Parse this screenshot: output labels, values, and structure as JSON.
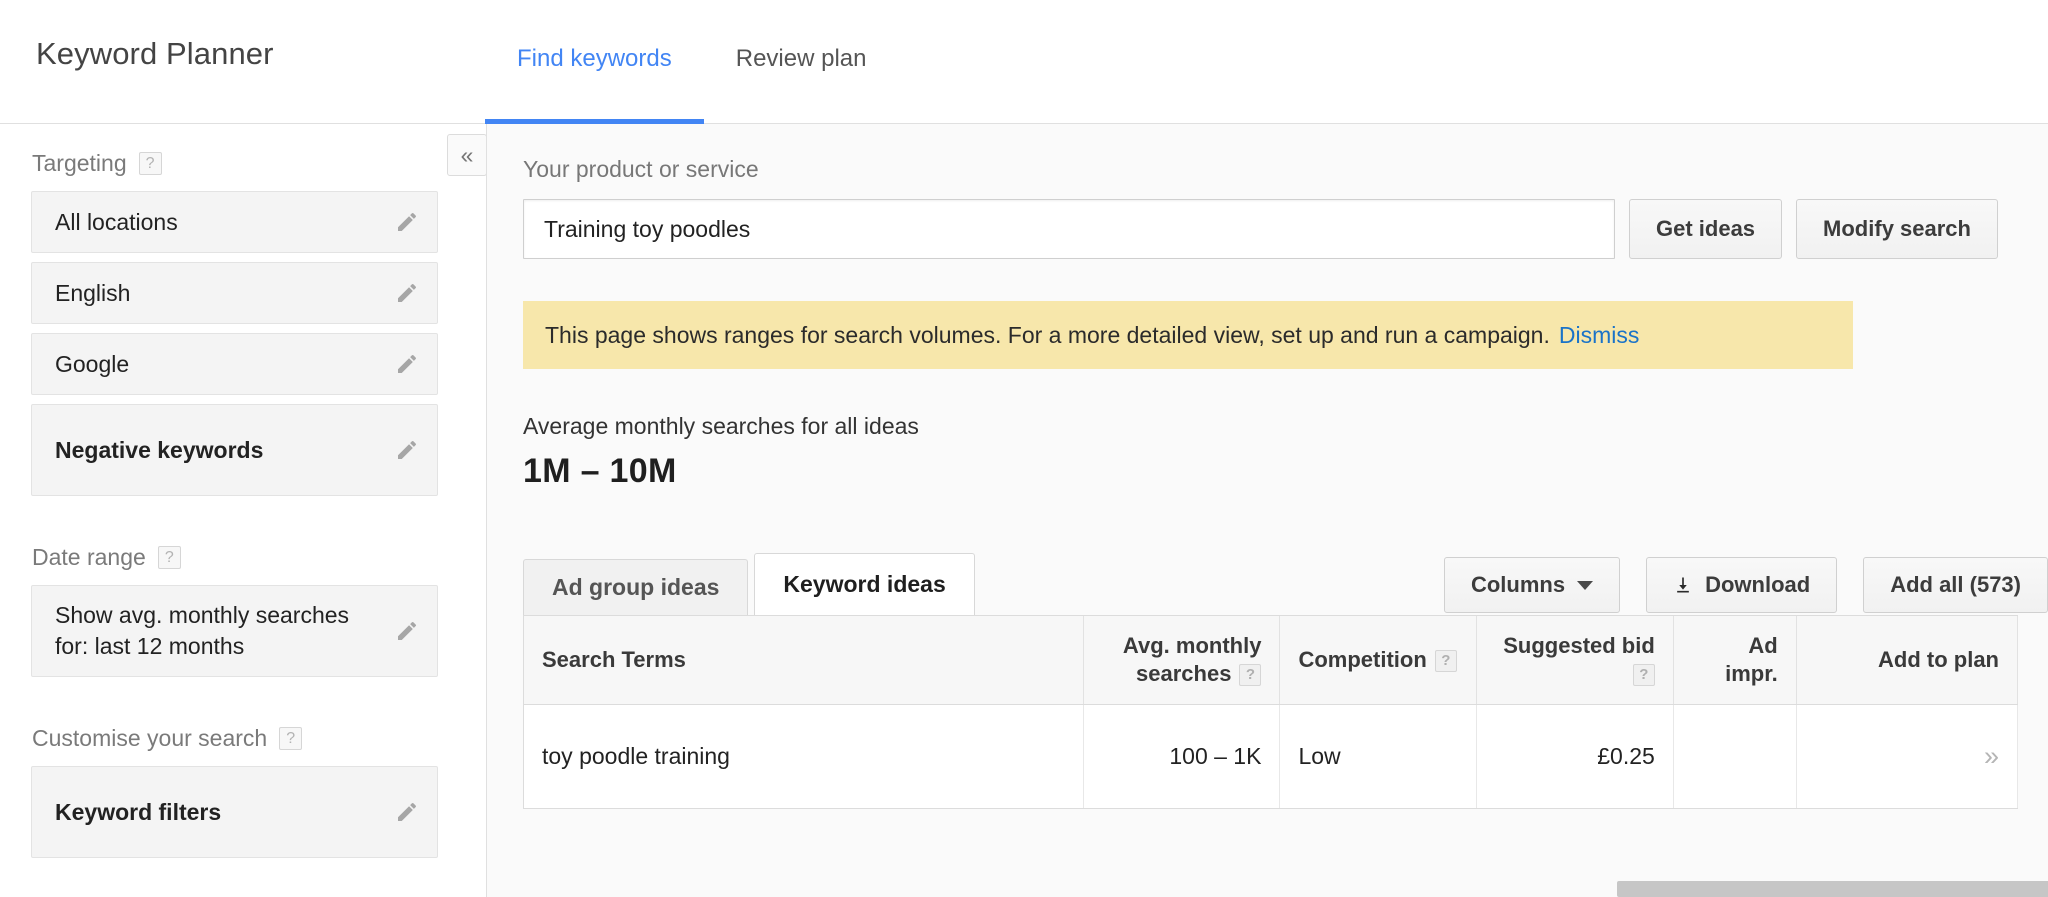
{
  "header": {
    "title": "Keyword Planner",
    "tabs": [
      {
        "label": "Find keywords",
        "active": true
      },
      {
        "label": "Review plan",
        "active": false
      }
    ]
  },
  "sidebar": {
    "collapse_icon": "«",
    "groups": [
      {
        "title": "Targeting",
        "help": "?",
        "items": [
          {
            "label": "All locations",
            "bold": false
          },
          {
            "label": "English",
            "bold": false
          },
          {
            "label": "Google",
            "bold": false
          },
          {
            "label": "Negative keywords",
            "bold": true
          }
        ]
      },
      {
        "title": "Date range",
        "help": "?",
        "items": [
          {
            "label": "Show avg. monthly searches for: last 12 months",
            "bold": false,
            "tall": true
          }
        ]
      },
      {
        "title": "Customise your search",
        "help": "?",
        "items": [
          {
            "label": "Keyword filters",
            "bold": true
          }
        ]
      }
    ]
  },
  "main": {
    "product_label": "Your product or service",
    "search_value": "Training toy poodles",
    "search_placeholder": "Your product or service",
    "get_ideas_label": "Get ideas",
    "modify_search_label": "Modify search",
    "banner_text": "This page shows ranges for search volumes. For a more detailed view, set up and run a campaign.",
    "banner_link": "Dismiss",
    "avg_label": "Average monthly searches for all ideas",
    "avg_value": "1M – 10M",
    "tabs": [
      {
        "label": "Ad group ideas",
        "active": false
      },
      {
        "label": "Keyword ideas",
        "active": true
      }
    ],
    "toolbar": {
      "columns_label": "Columns",
      "download_label": "Download",
      "add_all_label": "Add all (573)"
    },
    "table": {
      "columns": [
        {
          "label": "Search Terms",
          "help": false,
          "align": "left"
        },
        {
          "label": "Avg. monthly searches",
          "help": true,
          "align": "right"
        },
        {
          "label": "Competition",
          "help": true,
          "align": "left"
        },
        {
          "label": "Suggested bid",
          "help": true,
          "align": "right"
        },
        {
          "label": "Ad impr.",
          "help": false,
          "align": "right"
        },
        {
          "label": "Add to plan",
          "help": false,
          "align": "center"
        }
      ],
      "rows": [
        {
          "search_term": "toy poodle training",
          "avg_monthly_searches": "100 – 1K",
          "competition": "Low",
          "suggested_bid": "£0.25",
          "ad_impr": "",
          "add_to_plan": "»"
        }
      ]
    }
  },
  "colors": {
    "accent": "#4285f4",
    "banner_bg": "#f7e7ab",
    "link": "#1a73c8",
    "sidebar_item_bg": "#f4f4f4"
  }
}
